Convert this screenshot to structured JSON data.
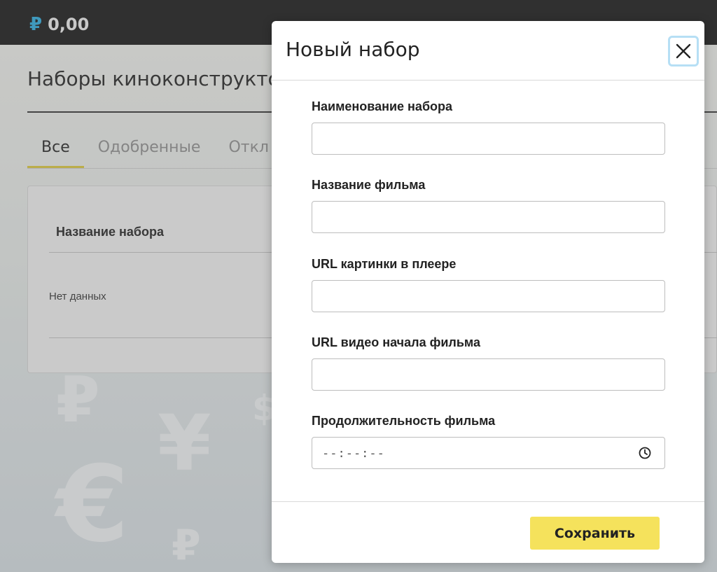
{
  "topbar": {
    "currency_symbol": "₽",
    "balance": "0,00"
  },
  "page": {
    "title": "Наборы киноконструктор",
    "tabs": [
      {
        "label": "Все",
        "active": true
      },
      {
        "label": "Одобренные",
        "active": false
      },
      {
        "label": "Откл",
        "active": false
      }
    ],
    "table": {
      "column_header": "Название набора",
      "empty_text": "Нет данных"
    }
  },
  "modal": {
    "title": "Новый набор",
    "close_icon": "close-icon",
    "fields": [
      {
        "label": "Наименование набора",
        "value": ""
      },
      {
        "label": "Название фильма",
        "value": ""
      },
      {
        "label": "URL картинки в плеере",
        "value": ""
      },
      {
        "label": "URL видео начала фильма",
        "value": ""
      },
      {
        "label": "Продолжительность фильма",
        "value": "--:--:--"
      }
    ],
    "save_label": "Сохранить"
  },
  "colors": {
    "accent_yellow": "#f5e25c",
    "ruble_blue": "#2aa7d8",
    "topbar": "#151515"
  }
}
